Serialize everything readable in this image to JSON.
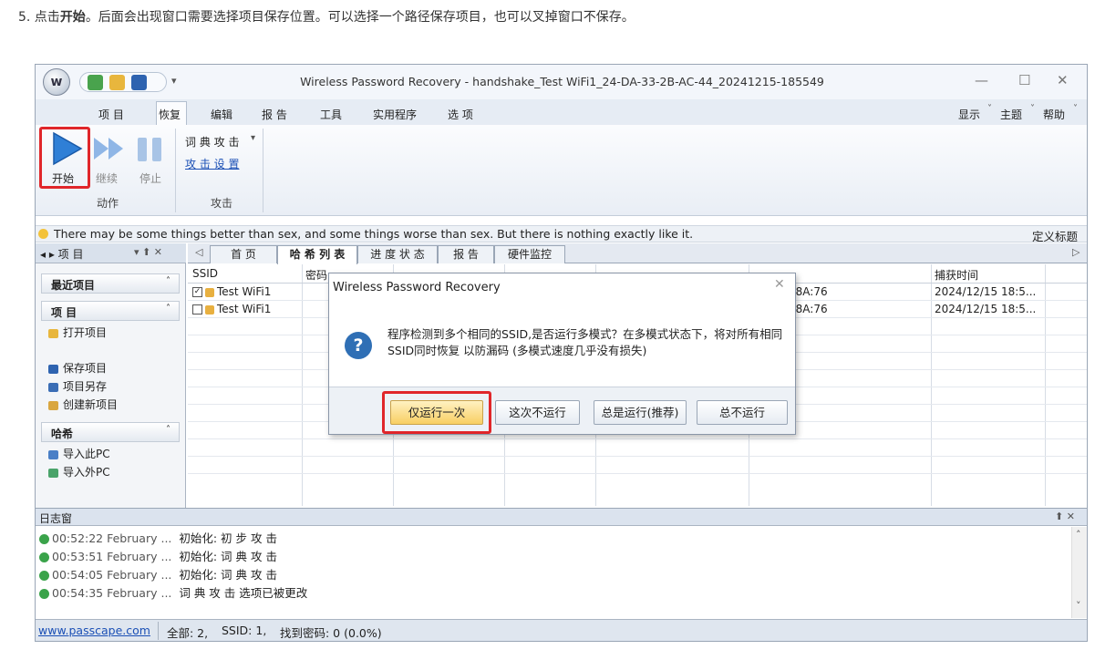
{
  "instruction": {
    "prefix": "5. 点击",
    "bold": "开始",
    "suffix": "。后面会出现窗口需要选择项目保存位置。可以选择一个路径保存项目，也可以叉掉窗口不保存。"
  },
  "window": {
    "title": "Wireless Password Recovery - handshake_Test WiFi1_24-DA-33-2B-AC-44_20241215-185549",
    "orb_letter": "w",
    "qat_dropdown": "▾",
    "caption": {
      "minimize": "—",
      "maximize": "☐",
      "close": "✕"
    }
  },
  "menu": {
    "items": [
      "项 目",
      "恢复",
      "编辑",
      "报 告",
      "工具",
      "实用程序",
      "选 项"
    ],
    "right": [
      "显示",
      "主题",
      "帮助"
    ],
    "right_arrow": "˅"
  },
  "ribbon": {
    "action_group": {
      "label": "动作",
      "start": "开始",
      "continue": "继续",
      "stop": "停止"
    },
    "attack_group": {
      "label": "攻击",
      "dict_attack": "词 典 攻 击",
      "dict_arrow": "▾",
      "attack_settings": "攻 击 设 置"
    }
  },
  "infobar": {
    "text": "There may be some things better than sex, and some things worse than sex. But there is nothing exactly like it.",
    "right": "定义标题"
  },
  "left_panel": {
    "header": "◂ ▸ 项 目",
    "header_controls": "▾ ⬆ ✕",
    "recent": "最近项目",
    "project_section": "项 目",
    "project_items": [
      "打开项目",
      "保存项目",
      "项目另存",
      "创建新项目"
    ],
    "hash_section": "哈希",
    "hash_items": [
      "导入此PC",
      "导入外PC"
    ],
    "section_arrow": "˄"
  },
  "tabs": {
    "nav_left": "◁",
    "nav_right": "▷",
    "items": [
      "首 页",
      "哈 希 列 表",
      "进 度 状 态",
      "报 告",
      "硬件监控"
    ],
    "active": 1
  },
  "grid": {
    "col_ssid": "SSID",
    "col_pwd": "密码",
    "col_time": "捕获时间",
    "rows": [
      {
        "ssid": "Test WiFi1",
        "checked": true,
        "mac": "3F:8A:76",
        "time": "2024/12/15 18:5..."
      },
      {
        "ssid": "Test WiFi1",
        "checked": false,
        "mac": "3F:8A:76",
        "time": "2024/12/15 18:5..."
      }
    ]
  },
  "dialog": {
    "title": "Wireless Password Recovery",
    "close": "✕",
    "icon": "?",
    "message": "程序检测到多个相同的SSID,是否运行多模式？在多模式状态下，将对所有相同SSID同时恢复 以防漏码 (多模式速度几乎没有损失)",
    "buttons": [
      "仅运行一次",
      "这次不运行",
      "总是运行(推荐)",
      "总不运行"
    ]
  },
  "log": {
    "title": "日志窗",
    "controls": "⬆ ✕",
    "lines": [
      {
        "time": "00:52:22 February ...",
        "msg": "初始化: 初 步 攻 击"
      },
      {
        "time": "00:53:51 February ...",
        "msg": "初始化: 词 典 攻 击"
      },
      {
        "time": "00:54:05 February ...",
        "msg": "初始化: 词 典 攻 击"
      },
      {
        "time": "00:54:35 February ...",
        "msg": "词 典 攻 击 选项已被更改"
      }
    ],
    "scroll_up": "˄",
    "scroll_down": "˅"
  },
  "status": {
    "link": "www.passcape.com",
    "total": "全部: 2,",
    "ssid": "SSID: 1,",
    "found": "找到密码: 0 (0.0%)"
  },
  "colors": {
    "accent_blue": "#2f7fd6",
    "highlight_red": "#e0262a",
    "dialog_default": "#f8cf63"
  }
}
